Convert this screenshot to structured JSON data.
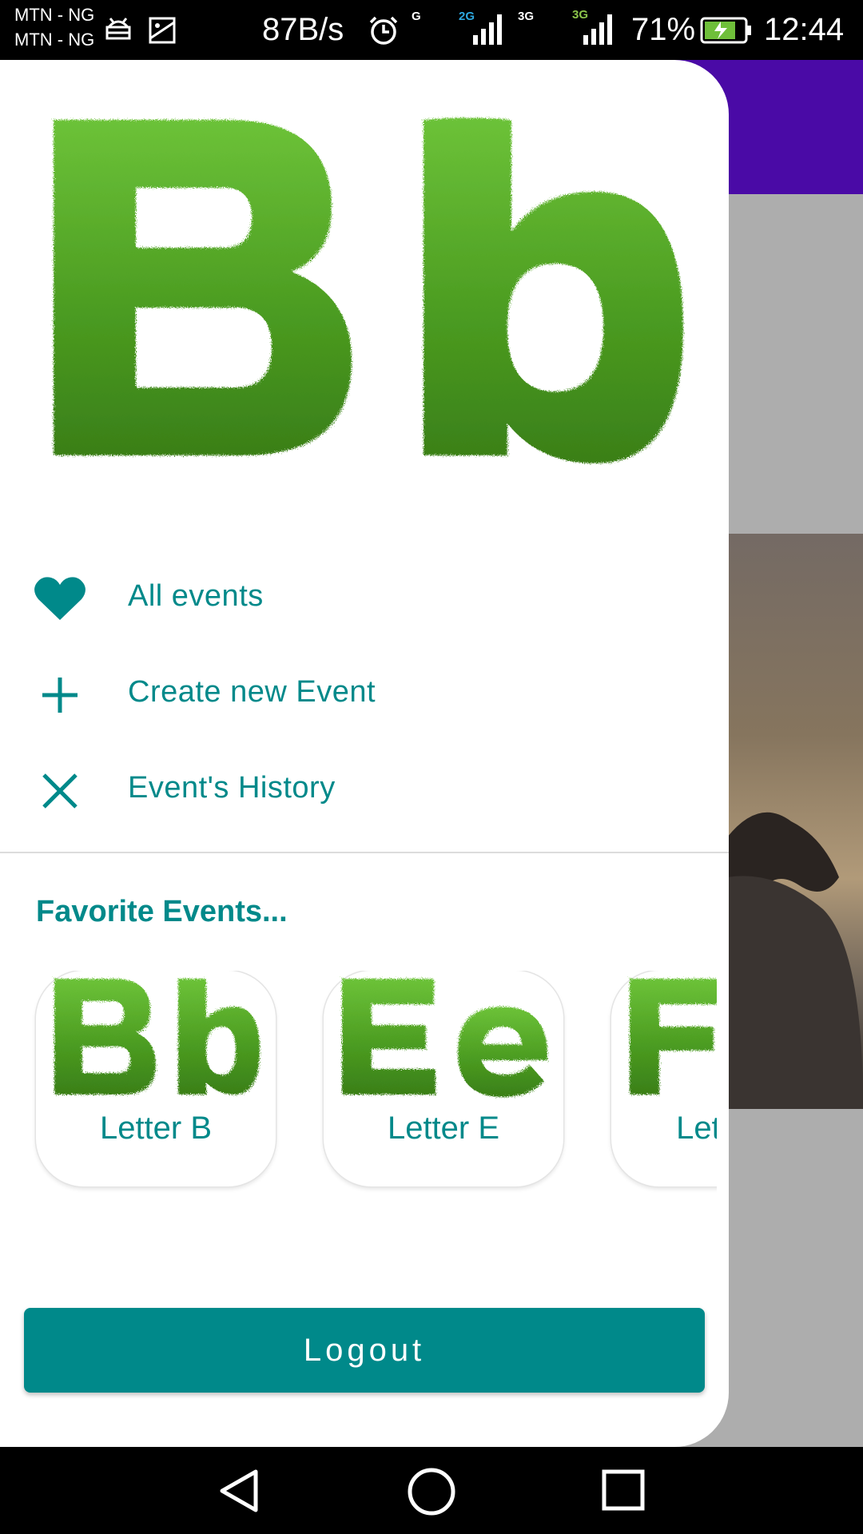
{
  "status_bar": {
    "carrier1": "MTN - NG",
    "carrier2": "MTN - NG",
    "net_speed": "87B/s",
    "g_label": "G",
    "sim1_type": "2G",
    "sim1_sub": "3G",
    "sim2_type": "3G",
    "battery": "71%",
    "time": "12:44",
    "icons": [
      "android-icon",
      "image-icon",
      "alarm-icon",
      "signal-icon",
      "battery-charging-icon"
    ]
  },
  "drawer": {
    "header_image": "grass-letters-bb",
    "menu": [
      {
        "label": "All events",
        "icon": "heart-icon"
      },
      {
        "label": "Create new Event",
        "icon": "plus-icon"
      },
      {
        "label": "Event's History",
        "icon": "close-icon"
      }
    ],
    "favorites_title": "Favorite Events...",
    "favorites": [
      {
        "label": "Letter B",
        "image": "grass-letters-bb"
      },
      {
        "label": "Letter E",
        "image": "grass-letters-ee"
      },
      {
        "label": "Letter F",
        "image": "grass-letters-ff"
      }
    ],
    "logout_label": "Logout"
  },
  "colors": {
    "accent": "#00898a",
    "app_bar": "#4a0aa6",
    "grass": "#4e9e22"
  },
  "nav_bar": {
    "icons": [
      "back-icon",
      "home-icon",
      "recents-icon"
    ]
  }
}
